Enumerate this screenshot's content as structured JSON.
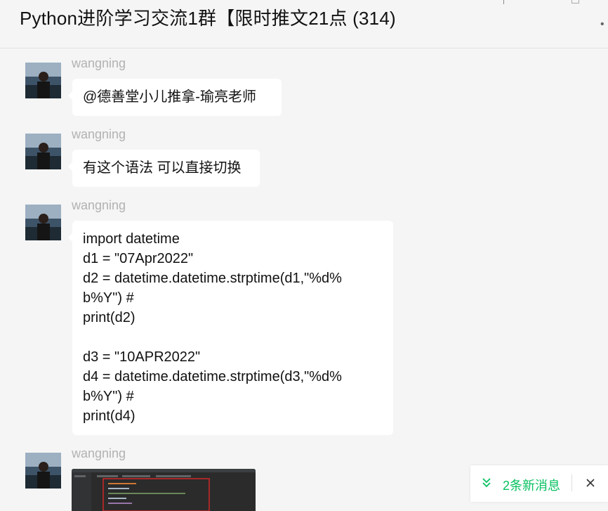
{
  "window": {
    "title": "Python进阶学习交流1群【限时推文21点 (314)",
    "more_icon": "ellipsis-icon"
  },
  "messages": [
    {
      "sender": "wangning",
      "text": "@德善堂小儿推拿-瑜亮老师"
    },
    {
      "sender": "wangning",
      "text": "有这个语法 可以直接切换"
    },
    {
      "sender": "wangning",
      "lines": [
        "import datetime",
        "d1 = \"07Apr2022\"",
        "d2 = datetime.datetime.strptime(d1,\"%d%",
        "b%Y\") #",
        "print(d2)",
        "",
        "d3 = \"10APR2022\"",
        "d4 = datetime.datetime.strptime(d3,\"%d%",
        "b%Y\") #",
        "print(d4)"
      ]
    },
    {
      "sender": "wangning",
      "image": "code-screenshot-thumbnail"
    }
  ],
  "new_message_notice": {
    "text": "2条新消息",
    "icon": "double-chevron-down-icon",
    "close_icon": "close-icon",
    "accent": "#07c160"
  },
  "colors": {
    "background": "#f5f5f5",
    "bubble": "#ffffff",
    "sender_name": "#b2b2b2"
  }
}
